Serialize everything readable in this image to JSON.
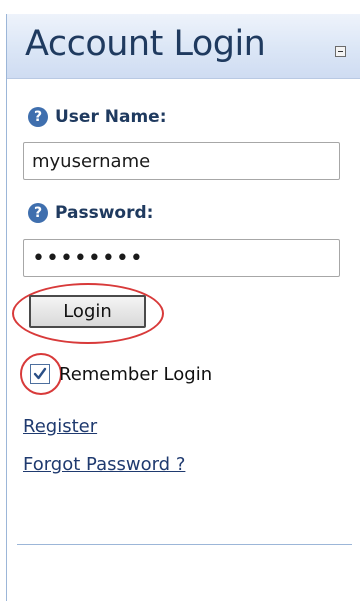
{
  "panel": {
    "title": "Account Login",
    "collapse_icon": "minus-box-icon"
  },
  "form": {
    "username": {
      "label": "User Name:",
      "help_icon": "question-circle-icon",
      "value": "myusername"
    },
    "password": {
      "label": "Password:",
      "help_icon": "question-circle-icon",
      "value": "••••••••"
    },
    "login_label": "Login",
    "remember": {
      "label": "Remember Login",
      "checked": true
    }
  },
  "links": {
    "register": "Register",
    "forgot": "Forgot Password ?"
  },
  "colors": {
    "header_bg": "#dbe6f6",
    "title_text": "#1f3a5f",
    "annotation_ring": "#d83a3a",
    "link": "#1f3a6f"
  }
}
